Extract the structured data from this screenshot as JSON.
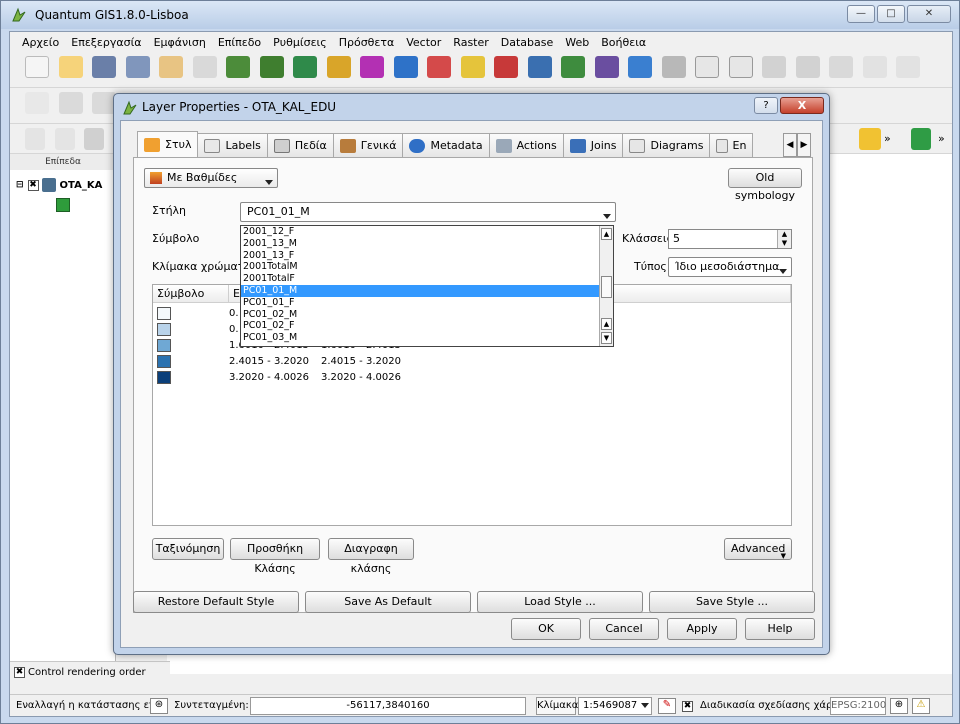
{
  "app": {
    "title": "Quantum GIS1.8.0-Lisboa",
    "menu": [
      "Αρχείο",
      "Επεξεργασία",
      "Εμφάνιση",
      "Επίπεδο",
      "Ρυθμίσεις",
      "Πρόσθετα",
      "Vector",
      "Raster",
      "Database",
      "Web",
      "Βοήθεια"
    ],
    "layers_panel": {
      "title": "Επίπεδα",
      "layer_name": "OTA_KA"
    },
    "control_rendering": "Control rendering order",
    "status": {
      "toggle_label": "Εναλλαγή η κατάστασης επεξ",
      "coord_label": "Συντεταγμένη:",
      "coord_value": "-56117,3840160",
      "scale_label": "Κλίμακα",
      "scale_value": "1:5469087",
      "render_label": "Διαδικασία σχεδίασης χάρτη",
      "epsg": "EPSG:2100"
    }
  },
  "dialog": {
    "title": "Layer Properties - OTA_KAL_EDU",
    "help_label": "?",
    "close_label": "X",
    "tabs": [
      {
        "label": "Στυλ",
        "icon": "brush-icon"
      },
      {
        "label": "Labels",
        "icon": "labels-icon"
      },
      {
        "label": "Πεδία",
        "icon": "table-icon"
      },
      {
        "label": "Γενικά",
        "icon": "tools-icon"
      },
      {
        "label": "Metadata",
        "icon": "info-icon"
      },
      {
        "label": "Actions",
        "icon": "gears-icon"
      },
      {
        "label": "Joins",
        "icon": "joins-icon"
      },
      {
        "label": "Diagrams",
        "icon": "diagrams-icon"
      },
      {
        "label": "En",
        "icon": "en-icon"
      }
    ],
    "renderer": "Με Βαθμίδες",
    "old_symbology": "Old symbology",
    "column_label": "Στήλη",
    "column_value": "PC01_01_M",
    "symbol_label": "Σύμβολο",
    "color_ramp_label": "Κλίμακα χρώματος",
    "classes_label": "Κλάσσεις",
    "classes_value": "5",
    "mode_label": "Τύπος",
    "mode_value": "Ίδιο μεσοδιάστημα",
    "table_headers": [
      "Σύμβολο",
      "Εύ"
    ],
    "rows": [
      {
        "color": "#f4f8fb",
        "range": "0.",
        "label": ""
      },
      {
        "color": "#b9d3ea",
        "range": "0.",
        "label": ""
      },
      {
        "color": "#6fa8d4",
        "range": "1.6010 - 2.4015",
        "label": "1.6010 - 2.4015"
      },
      {
        "color": "#2b72b0",
        "range": "2.4015 - 3.2020",
        "label": "2.4015 - 3.2020"
      },
      {
        "color": "#0b3f7a",
        "range": "3.2020 - 4.0026",
        "label": "3.2020 - 4.0026"
      }
    ],
    "dropdown_items": [
      "2001_12_F",
      "2001_13_M",
      "2001_13_F",
      "2001TotalM",
      "2001TotalF",
      "PC01_01_M",
      "PC01_01_F",
      "PC01_02_M",
      "PC01_02_F",
      "PC01_03_M"
    ],
    "dropdown_selected": "PC01_01_M",
    "buttons": {
      "classify": "Ταξινόμηση",
      "add_class": "Προσθήκη Κλάσης",
      "delete_class": "Διαγραφη κλάσης",
      "advanced": "Advanced",
      "restore": "Restore Default Style",
      "save_default": "Save As Default",
      "load_style": "Load Style ...",
      "save_style": "Save Style ...",
      "ok": "OK",
      "cancel": "Cancel",
      "apply": "Apply",
      "help": "Help"
    }
  }
}
